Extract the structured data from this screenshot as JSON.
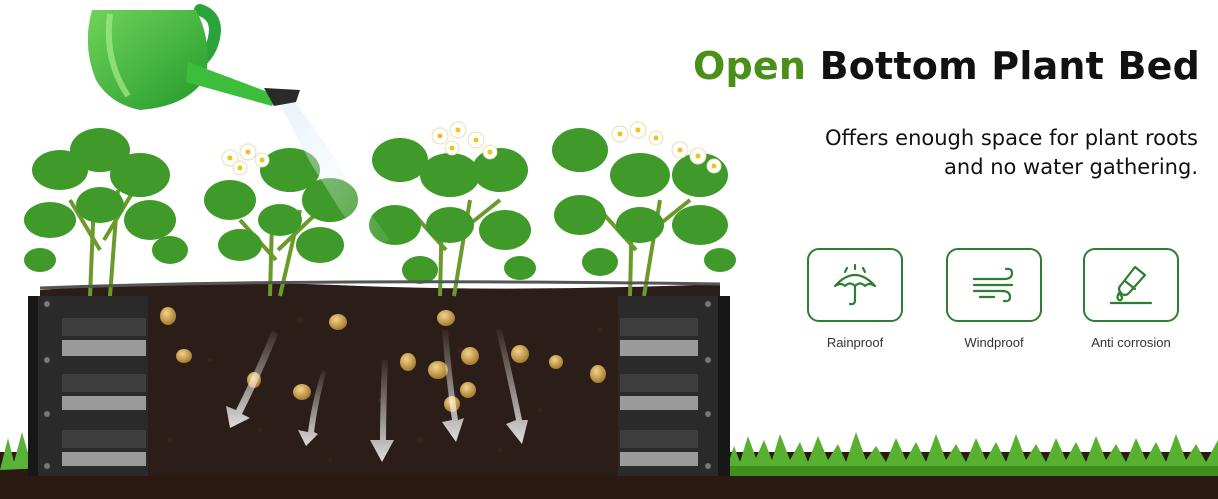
{
  "headline": {
    "accent": "Open",
    "rest": "Bottom Plant Bed"
  },
  "subtitle": {
    "line1": "Offers enough space for plant roots",
    "line2": "and no water gathering."
  },
  "features": [
    {
      "label": "Rainproof",
      "icon": "umbrella-rain-icon"
    },
    {
      "label": "Windproof",
      "icon": "wind-icon"
    },
    {
      "label": "Anti corrosion",
      "icon": "test-tube-drop-icon"
    }
  ],
  "colors": {
    "accent_green": "#4a8f17",
    "icon_green": "#2f7d32",
    "soil": "#2b1d17",
    "bed_metal": "#2a2a2a"
  }
}
